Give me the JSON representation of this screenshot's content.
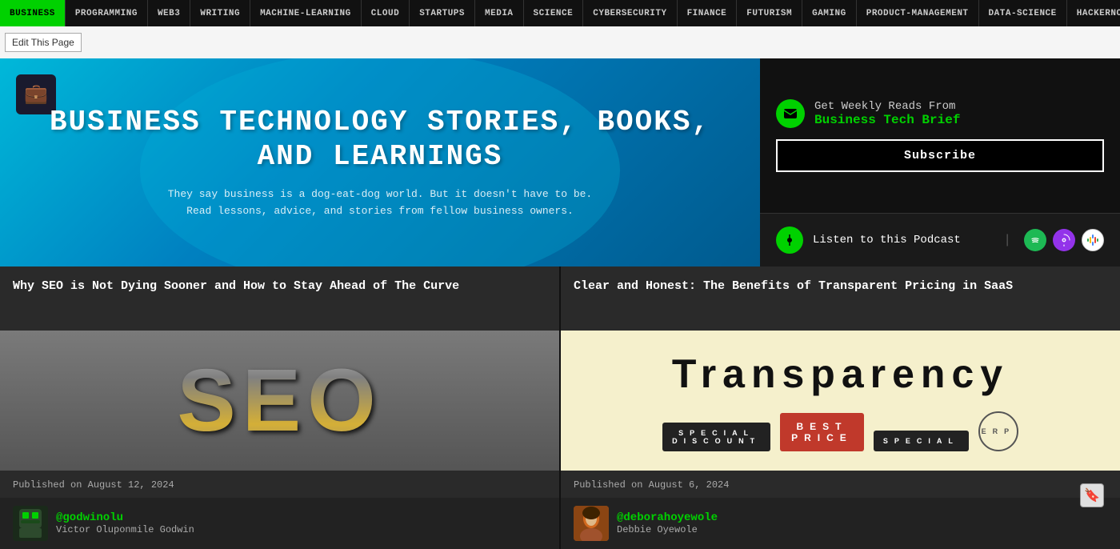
{
  "nav": {
    "items": [
      {
        "id": "business",
        "label": "BUSINESS",
        "active": true
      },
      {
        "id": "programming",
        "label": "PROGRAMMING",
        "active": false
      },
      {
        "id": "web3",
        "label": "WEB3",
        "active": false
      },
      {
        "id": "writing",
        "label": "WRITING",
        "active": false
      },
      {
        "id": "machine-learning",
        "label": "MACHINE-LEARNING",
        "active": false
      },
      {
        "id": "cloud",
        "label": "CLOUD",
        "active": false
      },
      {
        "id": "startups",
        "label": "STARTUPS",
        "active": false
      },
      {
        "id": "media",
        "label": "MEDIA",
        "active": false
      },
      {
        "id": "science",
        "label": "SCIENCE",
        "active": false
      },
      {
        "id": "cybersecurity",
        "label": "CYBERSECURITY",
        "active": false
      },
      {
        "id": "finance",
        "label": "FINANCE",
        "active": false
      },
      {
        "id": "futurism",
        "label": "FUTURISM",
        "active": false
      },
      {
        "id": "gaming",
        "label": "GAMING",
        "active": false
      },
      {
        "id": "product-management",
        "label": "PRODUCT-MANAGEMENT",
        "active": false
      },
      {
        "id": "data-science",
        "label": "DATA-SCIENCE",
        "active": false
      },
      {
        "id": "hackernoon",
        "label": "HACKERNOON",
        "active": false
      }
    ]
  },
  "editbar": {
    "label": "Edit This Page"
  },
  "hero": {
    "icon": "💼",
    "title": "BUSINESS TECHNOLOGY STORIES, BOOKS,\nAND LEARNINGS",
    "subtitle_line1": "They say business is a dog-eat-dog world. But it doesn't have to be.",
    "subtitle_line2": "Read lessons, advice, and stories from fellow business owners."
  },
  "sidebar": {
    "newsletter": {
      "label": "Get Weekly Reads From",
      "name": "Business Tech Brief",
      "subscribe_label": "Subscribe"
    },
    "podcast": {
      "label": "Listen to this Podcast",
      "platforms": [
        "Spotify",
        "Apple Podcasts",
        "Google Podcasts"
      ]
    }
  },
  "articles": [
    {
      "id": "article-1",
      "title": "Why SEO is Not Dying Sooner and How to Stay Ahead of The Curve",
      "image_type": "seo",
      "image_text": "SEO",
      "published": "Published on August 12, 2024",
      "author_handle": "@godwinolu",
      "author_name": "Victor Oluponmile Godwin",
      "author_avatar": "godwin"
    },
    {
      "id": "article-2",
      "title": "Clear and Honest: The Benefits of Transparent Pricing in SaaS",
      "image_type": "transparency",
      "image_text": "Transparency",
      "published": "Published on August 6, 2024",
      "author_handle": "@deborahoyewole",
      "author_name": "Debbie  Oyewole",
      "author_avatar": "deborah"
    }
  ],
  "floating": {
    "icon": "🔖"
  }
}
